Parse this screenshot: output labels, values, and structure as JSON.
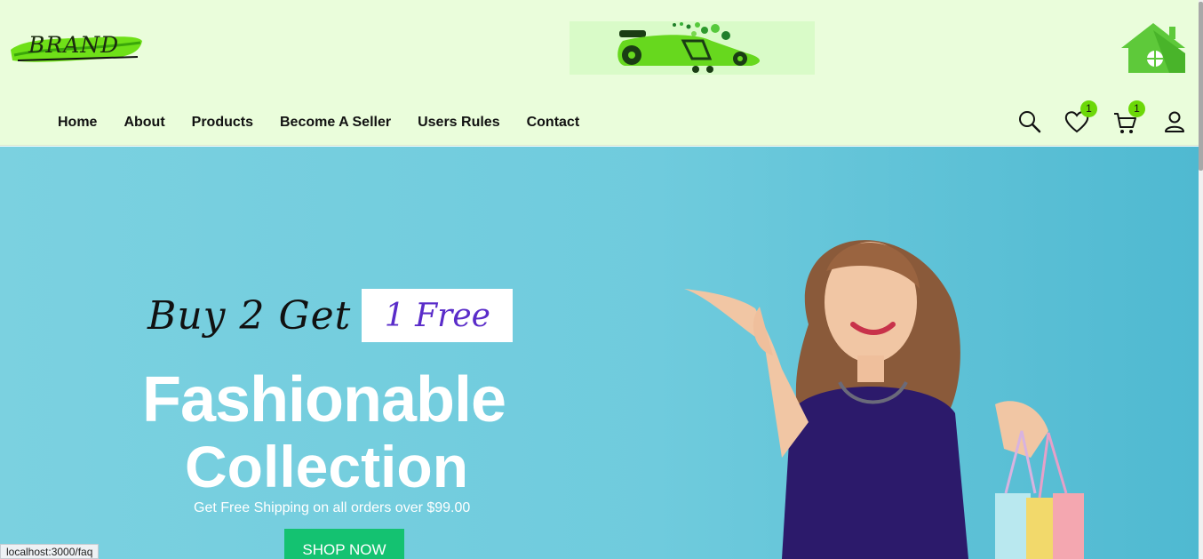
{
  "header": {
    "brand_text": "BRAND",
    "nav": [
      "Home",
      "About",
      "Products",
      "Become A Seller",
      "Users Rules",
      "Contact"
    ],
    "wishlist_count": "1",
    "cart_count": "1"
  },
  "hero": {
    "promo_left": "Buy 2 Get",
    "promo_right": "1 Free",
    "headline": "Fashionable",
    "subhead": "Collection",
    "shipping": "Get Free Shipping on all orders over $99.00",
    "cta": "SHOP NOW"
  },
  "status_bar": {
    "url": "localhost:3000/faq"
  },
  "colors": {
    "header_bg": "#eafddb",
    "accent_green": "#6cd808",
    "hero_bg": "#6fcbdd",
    "cta_bg": "#14c271",
    "promo_purple": "#5a2cc9"
  }
}
